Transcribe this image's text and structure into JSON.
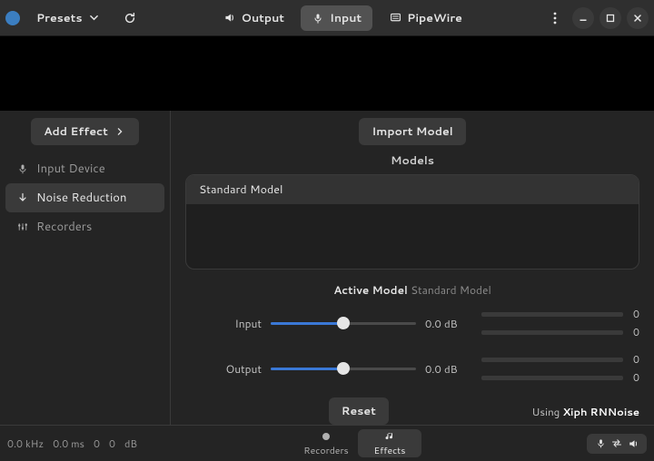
{
  "header": {
    "presets_label": "Presets",
    "tabs": {
      "output": "Output",
      "input": "Input",
      "pipewire": "PipeWire"
    },
    "active_tab": "input"
  },
  "sidebar": {
    "add_effect_label": "Add Effect",
    "items": [
      {
        "id": "input-device",
        "label": "Input Device"
      },
      {
        "id": "noise-reduction",
        "label": "Noise Reduction"
      },
      {
        "id": "recorders",
        "label": "Recorders"
      }
    ],
    "active": "noise-reduction"
  },
  "panel": {
    "import_model_label": "Import Model",
    "models_heading": "Models",
    "models": [
      "Standard Model"
    ],
    "active_model_label": "Active Model",
    "active_model_value": "Standard Model",
    "io": {
      "input_label": "Input",
      "output_label": "Output",
      "input_db": "0.0 dB",
      "output_db": "0.0 dB",
      "input_pos_pct": 50,
      "output_pos_pct": 50,
      "meter_values": [
        "0",
        "0",
        "0",
        "0"
      ]
    },
    "reset_label": "Reset",
    "using_prefix": "Using",
    "using_value": "Xiph RNNoise"
  },
  "footer": {
    "stats": {
      "freq": "0.0 kHz",
      "latency": "0.0 ms",
      "v1": "0",
      "v2": "0",
      "unit": "dB"
    },
    "switcher": {
      "recorders": "Recorders",
      "effects": "Effects",
      "active": "effects"
    }
  }
}
